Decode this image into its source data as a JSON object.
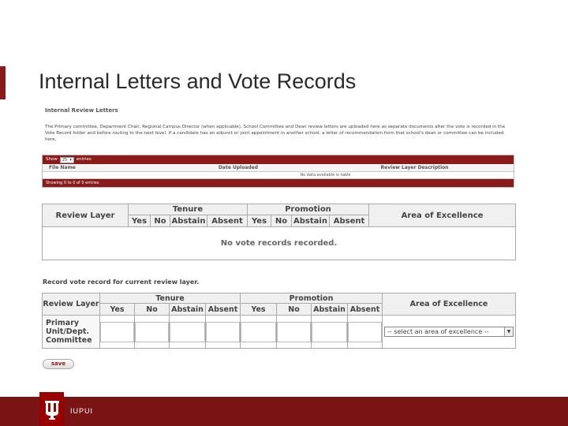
{
  "slide": {
    "title": "Internal Letters and Vote Records"
  },
  "letters": {
    "section_title": "Internal Review Letters",
    "description": "The Primary committee, Department Chair, Regional Campus Director (when applicable), School Committee and Dean review letters are uploaded here as separate documents after the vote is recorded in the Vote Record folder and before routing to the next level. If a candidate has an adjunct or joint appointment in another school, a letter of recommendation from that school's dean or committee can be included here.",
    "show_label": "Show",
    "show_value": "25",
    "entries_label": "entries",
    "columns": [
      "File Name",
      "Date Uploaded",
      "Review Layer Description"
    ],
    "empty_message": "No data available in table",
    "footer_info": "Showing 0 to 0 of 0 entries"
  },
  "votes_table": {
    "headers": {
      "review_layer": "Review Layer",
      "tenure": "Tenure",
      "promotion": "Promotion",
      "area": "Area of Excellence"
    },
    "sub_headers": [
      "Yes",
      "No",
      "Abstain",
      "Absent",
      "Yes",
      "No",
      "Abstain",
      "Absent"
    ],
    "empty_message": "No vote records recorded."
  },
  "record": {
    "title": "Record vote record for current review layer.",
    "headers": {
      "review_layer": "Review Layer",
      "tenure": "Tenure",
      "promotion": "Promotion",
      "area": "Area of Excellence"
    },
    "sub_headers": [
      "Yes",
      "No",
      "Abstain",
      "Absent",
      "Yes",
      "No",
      "Abstain",
      "Absent"
    ],
    "row_label": "Primary Unit/Dept. Committee",
    "select_placeholder": "-- select an area of excellence --",
    "save_label": "save"
  },
  "footer": {
    "brand": "IUPUI",
    "logo_icon": "iu-trident-icon",
    "color": "#7a1414",
    "accent_color": "#8b1a1a"
  }
}
